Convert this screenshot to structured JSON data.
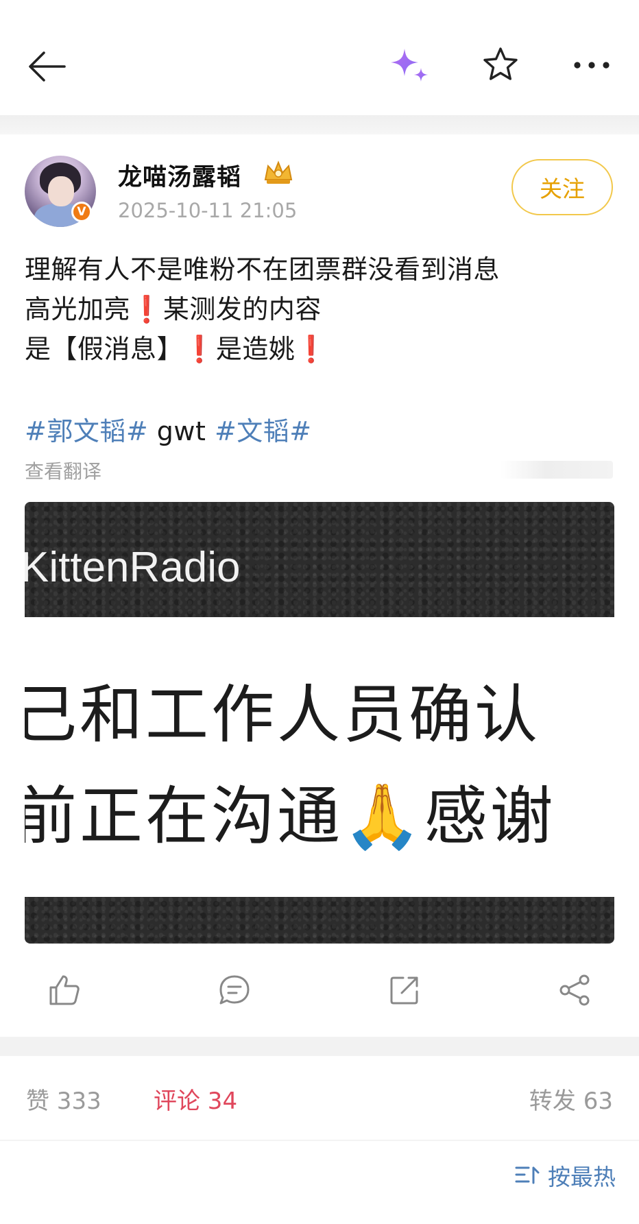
{
  "header": {
    "back_icon": "arrow-left-icon",
    "ai_icon": "sparkle-icon",
    "favorite_icon": "star-outline-icon",
    "more_icon": "more-horizontal-icon"
  },
  "author": {
    "name": "龙喵汤露韬",
    "time": "2025-10-11 21:05",
    "verified_badge": "V",
    "follow_label": "关注"
  },
  "post": {
    "lines": {
      "l1": "理解有人不是唯粉不在团票群没看到消息",
      "l2_a": "高光加亮",
      "l2_ex": "❗",
      "l2_b": "某测发的内容",
      "l3_a": "是【假消息】",
      "l3_ex1": "❗",
      "l3_b": "是造姚",
      "l3_ex2": "❗"
    },
    "tags": {
      "tag1": "#郭文韬#",
      "plain": " gwt ",
      "tag2": "#文韬#"
    },
    "translate_label": "查看翻译"
  },
  "media": {
    "radio_label": "KittenRadio",
    "line1": "己和工作人员确认",
    "line2_a": "前正在沟通",
    "line2_emoji": "🙏",
    "line2_b": "感谢"
  },
  "actions": {
    "like_icon": "thumbs-up-icon",
    "comment_icon": "comment-icon",
    "repost_icon": "repost-icon",
    "share_icon": "share-icon"
  },
  "stats": {
    "likes": "赞 333",
    "comments": "评论 34",
    "reposts": "转发 63"
  },
  "sort": {
    "label": "按最热",
    "icon": "sort-icon"
  },
  "colors": {
    "accent_follow": "#e6a000",
    "tag_blue": "#4e7fb8",
    "active_tab": "#e0475c"
  }
}
